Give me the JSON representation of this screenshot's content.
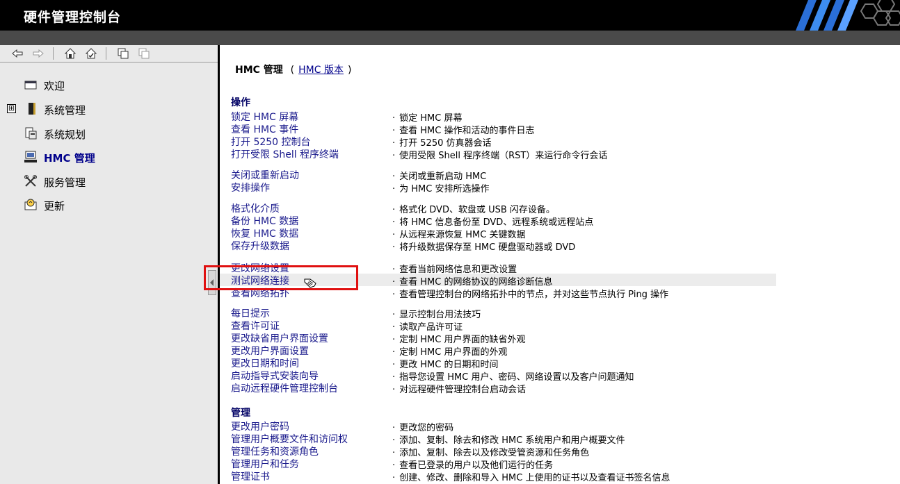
{
  "app": {
    "title": "硬件管理控制台"
  },
  "sidebar": {
    "toolbar": [
      {
        "name": "back-arrow-icon"
      },
      {
        "name": "forward-arrow-icon"
      },
      {
        "name": "home-icon"
      },
      {
        "name": "home-set-icon"
      },
      {
        "name": "expand-all-icon"
      },
      {
        "name": "collapse-all-icon"
      }
    ],
    "items": [
      {
        "label": "欢迎",
        "icon": "welcome-window-icon"
      },
      {
        "label": "系统管理",
        "icon": "server-icon",
        "expander": "⊞"
      },
      {
        "label": "系统规划",
        "icon": "planning-icon"
      },
      {
        "label": "HMC 管理",
        "icon": "hmc-console-icon",
        "active": true
      },
      {
        "label": "服务管理",
        "icon": "service-tools-icon"
      },
      {
        "label": "更新",
        "icon": "update-icon"
      }
    ]
  },
  "main": {
    "heading": {
      "title": "HMC 管理",
      "open_paren": "(",
      "version_link": "HMC 版本",
      "close_paren": ")"
    },
    "sections": [
      {
        "title": "操作",
        "groups": [
          [
            {
              "link": "锁定 HMC 屏幕",
              "desc": "锁定 HMC 屏幕"
            },
            {
              "link": "查看 HMC 事件",
              "desc": "查看 HMC 操作和活动的事件日志"
            },
            {
              "link": "打开 5250 控制台",
              "desc": "打开 5250 仿真器会话"
            },
            {
              "link": "打开受限 Shell 程序终端",
              "desc": "使用受限 Shell 程序终端（RST）来运行命令行会话"
            }
          ],
          [
            {
              "link": "关闭或重新启动",
              "desc": "关闭或重新启动 HMC"
            },
            {
              "link": "安排操作",
              "desc": "为 HMC 安排所选操作"
            }
          ],
          [
            {
              "link": "格式化介质",
              "desc": "格式化 DVD、软盘或 USB 闪存设备。"
            },
            {
              "link": "备份 HMC 数据",
              "desc": "将 HMC 信息备份至 DVD、远程系统或远程站点"
            },
            {
              "link": "恢复 HMC 数据",
              "desc": "从远程来源恢复 HMC 关键数据"
            },
            {
              "link": "保存升级数据",
              "desc": "将升级数据保存至 HMC 硬盘驱动器或 DVD"
            }
          ],
          [
            {
              "link": "更改网络设置",
              "desc": "查看当前网络信息和更改设置"
            },
            {
              "link": "测试网络连接",
              "desc": "查看 HMC 的网络协议的网络诊断信息",
              "hover": true
            },
            {
              "link": "查看网络拓扑",
              "desc": "查看管理控制台的网络拓扑中的节点，并对这些节点执行 Ping 操作"
            }
          ],
          [
            {
              "link": "每日提示",
              "desc": "显示控制台用法技巧"
            },
            {
              "link": "查看许可证",
              "desc": "读取产品许可证"
            },
            {
              "link": "更改缺省用户界面设置",
              "desc": "定制 HMC 用户界面的缺省外观"
            },
            {
              "link": "更改用户界面设置",
              "desc": "定制 HMC 用户界面的外观"
            },
            {
              "link": "更改日期和时间",
              "desc": "更改 HMC 的日期和时间"
            },
            {
              "link": "启动指导式安装向导",
              "desc": "指导您设置 HMC 用户、密码、网络设置以及客户问题通知"
            },
            {
              "link": "启动远程硬件管理控制台",
              "desc": "对远程硬件管理控制台启动会话"
            }
          ]
        ]
      },
      {
        "title": "管理",
        "groups": [
          [
            {
              "link": "更改用户密码",
              "desc": "更改您的密码"
            },
            {
              "link": "管理用户概要文件和访问权",
              "desc": "添加、复制、除去和修改 HMC 系统用户和用户概要文件"
            },
            {
              "link": "管理任务和资源角色",
              "desc": "添加、复制、除去以及修改受管资源和任务角色"
            },
            {
              "link": "管理用户和任务",
              "desc": "查看已登录的用户以及他们运行的任务"
            },
            {
              "link": "管理证书",
              "desc": "创建、修改、删除和导入 HMC 上使用的证书以及查看证书签名信息"
            }
          ]
        ]
      }
    ]
  },
  "colors": {
    "highlight": "#e01010",
    "link": "#1a1a8c",
    "titlebar": "#000000"
  }
}
